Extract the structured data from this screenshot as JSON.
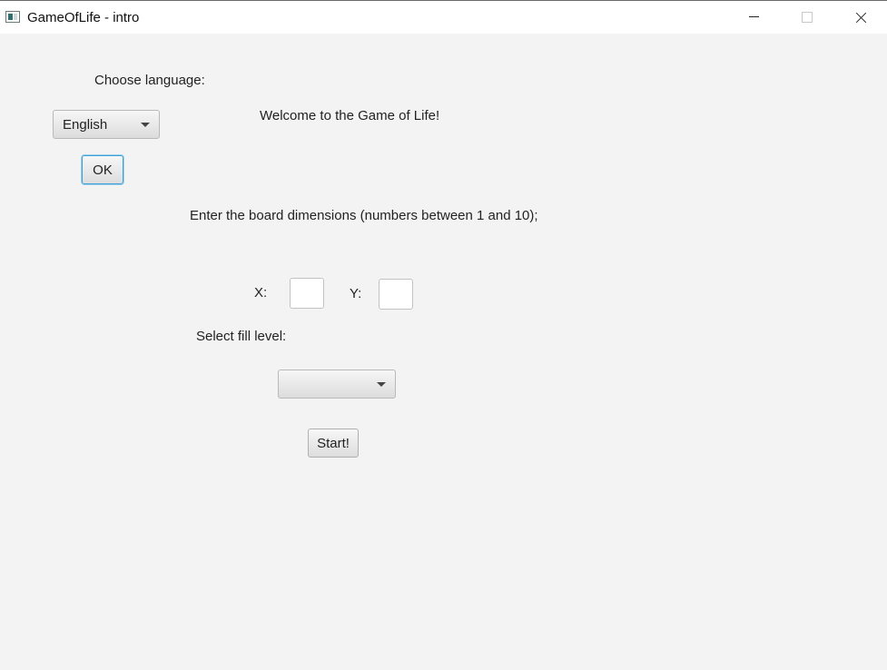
{
  "window": {
    "title": "GameOfLife - intro"
  },
  "language": {
    "label": "Choose language:",
    "selected": "English",
    "ok_label": "OK"
  },
  "welcome": "Welcome to the Game of Life!",
  "dimensions": {
    "prompt": "Enter the board dimensions (numbers between 1 and 10);",
    "x_label": "X:",
    "y_label": "Y:",
    "x_value": "",
    "y_value": ""
  },
  "fill": {
    "label": "Select fill level:",
    "selected": ""
  },
  "start_label": "Start!"
}
